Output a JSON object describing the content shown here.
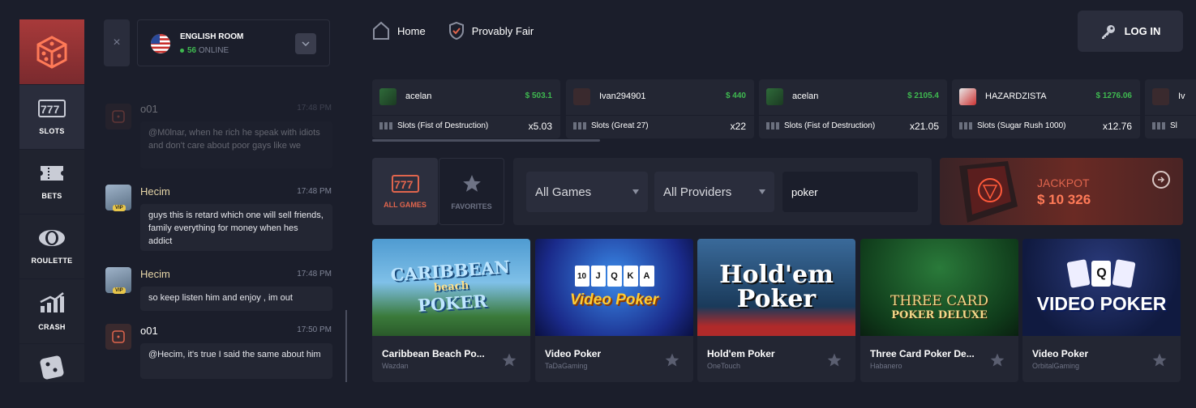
{
  "nav": {
    "items": [
      {
        "label": "SLOTS",
        "icon": "slots-icon",
        "active": true
      },
      {
        "label": "BETS",
        "icon": "ticket-icon",
        "active": false
      },
      {
        "label": "ROULETTE",
        "icon": "roulette-icon",
        "active": false
      },
      {
        "label": "CRASH",
        "icon": "crash-chart-icon",
        "active": false
      },
      {
        "label": "",
        "icon": "dice-icon",
        "active": false
      }
    ]
  },
  "chat": {
    "close_label": "×",
    "room_name": "ENGLISH ROOM",
    "online_count": "56",
    "online_label": "ONLINE",
    "messages": [
      {
        "user": "o01",
        "time": "17:48 PM",
        "text": "@M0lnar, when he rich he speak with idiots and don't care about poor gays like we"
      },
      {
        "user": "Hecim",
        "time": "17:48 PM",
        "text": "guys this is retard which one will sell friends, family everything for money when hes addict",
        "badge": "VIP"
      },
      {
        "user": "Hecim",
        "time": "17:48 PM",
        "text": "so keep listen him and enjoy , im out",
        "badge": "VIP"
      },
      {
        "user": "o01",
        "time": "17:50 PM",
        "text": "@Hecim, it's true I said the same about him"
      }
    ]
  },
  "header": {
    "home_label": "Home",
    "fair_label": "Provably Fair",
    "login_label": "LOG IN"
  },
  "ticker": [
    {
      "user": "acelan",
      "amount": "$ 503.1",
      "game": "Slots (Fist of Destruction)",
      "mult": "x5.03"
    },
    {
      "user": "Ivan294901",
      "amount": "$ 440",
      "game": "Slots (Great 27)",
      "mult": "x22"
    },
    {
      "user": "acelan",
      "amount": "$ 2105.4",
      "game": "Slots (Fist of Destruction)",
      "mult": "x21.05"
    },
    {
      "user": "HAZARDZISTA",
      "amount": "$ 1276.06",
      "game": "Slots (Sugar Rush 1000)",
      "mult": "x12.76"
    },
    {
      "user": "Iv",
      "amount": "",
      "game": "Sl",
      "mult": ""
    }
  ],
  "filters": {
    "all_games_tab": "ALL GAMES",
    "favorites_tab": "FAVORITES",
    "games_select": "All Games",
    "providers_select": "All Providers",
    "search_value": "poker"
  },
  "jackpot": {
    "label": "JACKPOT",
    "value": "$ 10 326"
  },
  "games": [
    {
      "title": "Caribbean Beach Po...",
      "provider": "Wazdan",
      "art_lines": [
        "CARIBBEAN",
        "beach",
        "POKER"
      ]
    },
    {
      "title": "Video Poker",
      "provider": "TaDaGaming",
      "art_lines": [
        "Video Poker"
      ]
    },
    {
      "title": "Hold'em Poker",
      "provider": "OneTouch",
      "art_lines": [
        "Hold'em",
        "Poker"
      ]
    },
    {
      "title": "Three Card Poker De...",
      "provider": "Habanero",
      "art_lines": [
        "THREE CARD",
        "POKER DELUXE"
      ]
    },
    {
      "title": "Video Poker",
      "provider": "OrbitalGaming",
      "art_lines": [
        "VIDEO POKER"
      ]
    }
  ],
  "colors": {
    "accent": "#e0654d",
    "green": "#3fb950",
    "bg": "#1b1e2b",
    "panel": "#232633"
  }
}
